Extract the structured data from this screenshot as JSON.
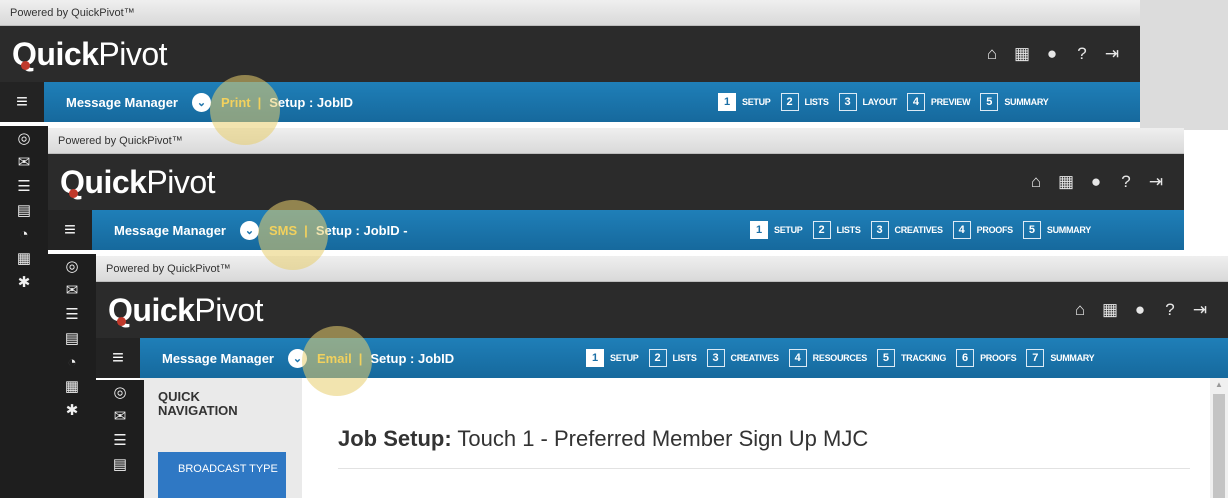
{
  "powered_by": "Powered by QuickPivot™",
  "logo": {
    "bold": "Quick",
    "light": "Pivot"
  },
  "top_icons": [
    "home-icon",
    "calendar-icon",
    "user-icon",
    "help-icon",
    "logout-icon"
  ],
  "sidebar_icons": [
    "menu-icon",
    "target-icon",
    "envelope-icon",
    "database-icon",
    "document-icon",
    "pie-chart-icon",
    "table-icon",
    "gear-icon"
  ],
  "module_label": "Message Manager",
  "separator": "|",
  "panels": [
    {
      "channel": "Print",
      "setup": "Setup : JobID",
      "steps": [
        {
          "num": "1",
          "label": "SETUP",
          "active": true
        },
        {
          "num": "2",
          "label": "LISTS"
        },
        {
          "num": "3",
          "label": "LAYOUT"
        },
        {
          "num": "4",
          "label": "PREVIEW"
        },
        {
          "num": "5",
          "label": "SUMMARY"
        }
      ]
    },
    {
      "channel": "SMS",
      "setup": "Setup : JobID -",
      "steps": [
        {
          "num": "1",
          "label": "SETUP",
          "active": true
        },
        {
          "num": "2",
          "label": "LISTS"
        },
        {
          "num": "3",
          "label": "CREATIVES"
        },
        {
          "num": "4",
          "label": "PROOFS"
        },
        {
          "num": "5",
          "label": "SUMMARY"
        }
      ]
    },
    {
      "channel": "Email",
      "setup": "Setup : JobID",
      "steps": [
        {
          "num": "1",
          "label": "SETUP",
          "active": true
        },
        {
          "num": "2",
          "label": "LISTS"
        },
        {
          "num": "3",
          "label": "CREATIVES"
        },
        {
          "num": "4",
          "label": "RESOURCES"
        },
        {
          "num": "5",
          "label": "TRACKING"
        },
        {
          "num": "6",
          "label": "PROOFS"
        },
        {
          "num": "7",
          "label": "SUMMARY"
        }
      ]
    }
  ],
  "quick_navigation": "QUICK NAVIGATION",
  "broadcast_type": "BROADCAST TYPE",
  "job_setup": {
    "prefix": "Job Setup:",
    "title": "Touch 1 - Preferred Member Sign Up MJC"
  },
  "colors": {
    "brand_bar": "#2b2b2b",
    "nav_blue": "#1a72aa",
    "channel_yellow": "#ffd54a",
    "highlight": "#e8cd6e",
    "broadcast_blue": "#2f78c4"
  }
}
